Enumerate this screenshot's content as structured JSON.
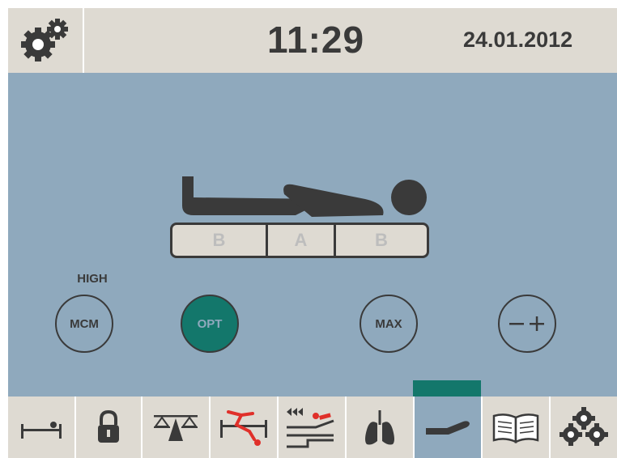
{
  "header": {
    "time": "11:29",
    "date": "24.01.2012",
    "settings_icon": "gears-icon"
  },
  "therapy": {
    "zones": [
      "B",
      "A",
      "B"
    ],
    "level_label": "HIGH",
    "buttons": {
      "mcm": "MCM",
      "opt": "OPT",
      "max": "MAX"
    },
    "active_mode": "OPT"
  },
  "toolbar": {
    "items": [
      {
        "icon": "patient-bed-icon"
      },
      {
        "icon": "padlock-icon"
      },
      {
        "icon": "scale-icon"
      },
      {
        "icon": "patient-fall-icon"
      },
      {
        "icon": "bed-positions-icon"
      },
      {
        "icon": "lungs-icon"
      },
      {
        "icon": "mattress-patient-icon"
      },
      {
        "icon": "manual-book-icon"
      },
      {
        "icon": "gears-icon"
      }
    ],
    "selected_index": 6
  },
  "colors": {
    "panel": "#8fa9bd",
    "bar": "#dedad2",
    "accent": "#13776b",
    "ink": "#3a3a3a",
    "alert": "#e0302a"
  }
}
